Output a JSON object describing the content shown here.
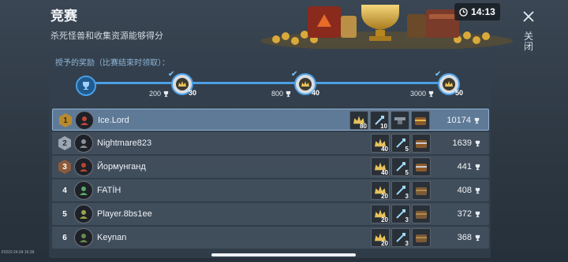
{
  "header": {
    "title": "竞赛",
    "subtitle": "杀死怪兽和收集资源能够得分",
    "timer": "14:13",
    "close_label": "关闭"
  },
  "rewards": {
    "label": "授予的奖励（比赛结束时领取）：",
    "milestones": [
      {
        "threshold": "200",
        "reward": "30"
      },
      {
        "threshold": "800",
        "reward": "40"
      },
      {
        "threshold": "3000",
        "reward": "50"
      }
    ]
  },
  "leaderboard": [
    {
      "rank": "1",
      "name": "Ice.Lord",
      "items": [
        "80",
        "10",
        "",
        ""
      ],
      "score": "10174"
    },
    {
      "rank": "2",
      "name": "Nightmare823",
      "items": [
        "40",
        "5",
        ""
      ],
      "score": "1639"
    },
    {
      "rank": "3",
      "name": "Йормунганд",
      "items": [
        "40",
        "5",
        ""
      ],
      "score": "441"
    },
    {
      "rank": "4",
      "name": "FATİH",
      "items": [
        "20",
        "3",
        ""
      ],
      "score": "408"
    },
    {
      "rank": "5",
      "name": "Player.8bs1ee",
      "items": [
        "20",
        "3",
        ""
      ],
      "score": "372"
    },
    {
      "rank": "6",
      "name": "Keynan",
      "items": [
        "20",
        "3",
        ""
      ],
      "score": "368"
    }
  ],
  "footer": {
    "tiny_text": "FID10 24.04 16:39"
  },
  "colors": {
    "accent": "#4a9fe6",
    "highlight_row": "#5f7a97",
    "panel": "#34404d"
  }
}
